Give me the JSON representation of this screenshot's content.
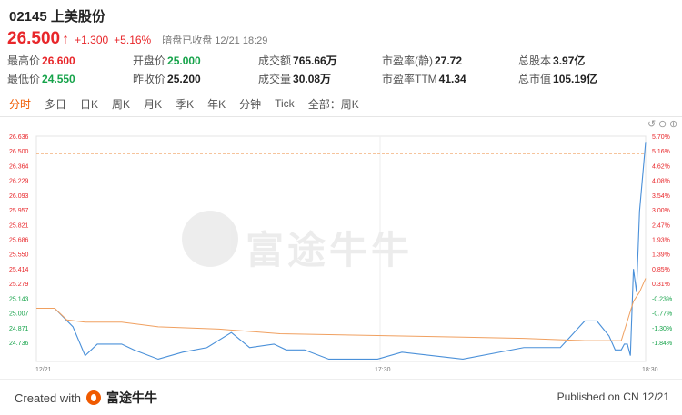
{
  "header": {
    "title": "02145 上美股份",
    "price": "26.500",
    "change": "+1.300",
    "change_pct": "+5.16%",
    "status": "暗盘已收盘 12/21 18:29"
  },
  "stats": [
    {
      "label": "最高价",
      "value": "26.600",
      "tone": "up"
    },
    {
      "label": "开盘价",
      "value": "25.000",
      "tone": "down"
    },
    {
      "label": "成交额",
      "value": "765.66万",
      "tone": ""
    },
    {
      "label": "市盈率(静)",
      "value": "27.72",
      "tone": ""
    },
    {
      "label": "总股本",
      "value": "3.97亿",
      "tone": ""
    },
    {
      "label": "最低价",
      "value": "24.550",
      "tone": "down"
    },
    {
      "label": "昨收价",
      "value": "25.200",
      "tone": ""
    },
    {
      "label": "成交量",
      "value": "30.08万",
      "tone": ""
    },
    {
      "label": "市盈率TTM",
      "value": "41.34",
      "tone": ""
    },
    {
      "label": "总市值",
      "value": "105.19亿",
      "tone": ""
    }
  ],
  "tabs": [
    "分时",
    "多日",
    "日K",
    "周K",
    "月K",
    "季K",
    "年K",
    "分钟",
    "Tick",
    "全部：周K"
  ],
  "active_tab": 0,
  "controls": [
    "undo-icon",
    "zoom-out-icon",
    "zoom-in-icon"
  ],
  "footer": {
    "created_with": "Created with",
    "brand": "富途牛牛",
    "published": "Published on CN 12/21"
  },
  "watermark": "富途牛牛",
  "colors": {
    "up": "#e8262a",
    "down": "#16a34a",
    "accent": "#f05a00",
    "price_line": "#4a90d9",
    "avg_line": "#f0a060",
    "ref_line": "#f0a060"
  },
  "chart_data": {
    "type": "line",
    "x_ticks": [
      "12/21",
      "17:30",
      "18:30"
    ],
    "y_left_ticks": [
      "26.636",
      "26.500",
      "26.364",
      "26.229",
      "26.093",
      "25.957",
      "25.821",
      "25.686",
      "25.550",
      "25.414",
      "25.279",
      "25.143",
      "25.007",
      "24.871",
      "24.736"
    ],
    "y_right_ticks": [
      "5.70%",
      "5.16%",
      "4.62%",
      "4.08%",
      "3.54%",
      "3.00%",
      "2.47%",
      "1.93%",
      "1.39%",
      "0.85%",
      "0.31%",
      "-0.23%",
      "-0.77%",
      "-1.30%",
      "-1.84%"
    ],
    "ylim": [
      24.7,
      26.65
    ],
    "reference_price": 26.5,
    "prev_close": 25.2,
    "series": [
      {
        "role": "price",
        "x": [
          0,
          3,
          6,
          8,
          10,
          14,
          16,
          20,
          24,
          28,
          32,
          35,
          39,
          41,
          44,
          48,
          52,
          56,
          60,
          70,
          80,
          86,
          90,
          92,
          94,
          95,
          96,
          96.5,
          97,
          97.5,
          98,
          98.5,
          99,
          100
        ],
        "y": [
          25.16,
          25.16,
          25.0,
          24.75,
          24.85,
          24.85,
          24.8,
          24.72,
          24.78,
          24.82,
          24.95,
          24.82,
          24.85,
          24.8,
          24.8,
          24.72,
          24.72,
          24.72,
          24.78,
          24.72,
          24.82,
          24.82,
          25.05,
          25.05,
          24.92,
          24.8,
          24.8,
          24.85,
          24.85,
          24.75,
          25.5,
          25.3,
          26.0,
          26.6
        ]
      },
      {
        "role": "average",
        "x": [
          0,
          3,
          5,
          8,
          14,
          20,
          30,
          40,
          50,
          60,
          70,
          80,
          90,
          96,
          97,
          98,
          99,
          100
        ],
        "y": [
          25.16,
          25.16,
          25.06,
          25.04,
          25.04,
          25.0,
          24.98,
          24.94,
          24.93,
          24.92,
          24.91,
          24.9,
          24.88,
          24.88,
          25.05,
          25.22,
          25.3,
          25.42
        ]
      }
    ]
  }
}
